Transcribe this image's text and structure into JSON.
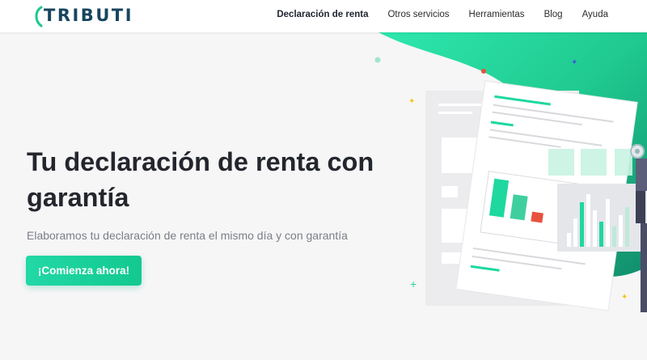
{
  "brand": {
    "name": "TRIBUTI"
  },
  "nav": {
    "items": [
      {
        "label": "Declaración de renta",
        "active": true
      },
      {
        "label": "Otros servicios",
        "active": false
      },
      {
        "label": "Herramientas",
        "active": false
      },
      {
        "label": "Blog",
        "active": false
      },
      {
        "label": "Ayuda",
        "active": false
      }
    ]
  },
  "hero": {
    "title": "Tu declaración de renta con garantía",
    "subtitle": "Elaboramos tu declaración de renta el mismo día y con garantía",
    "cta_label": "¡Comienza ahora!"
  },
  "colors": {
    "accent": "#1ed8a0",
    "accent_dark": "#10a577",
    "brand_text": "#17455f",
    "chart_red": "#e8523f"
  },
  "icons": [
    "logo-arc-icon",
    "gear-icon",
    "sparkle-icon",
    "plus-icon",
    "star-icon"
  ]
}
